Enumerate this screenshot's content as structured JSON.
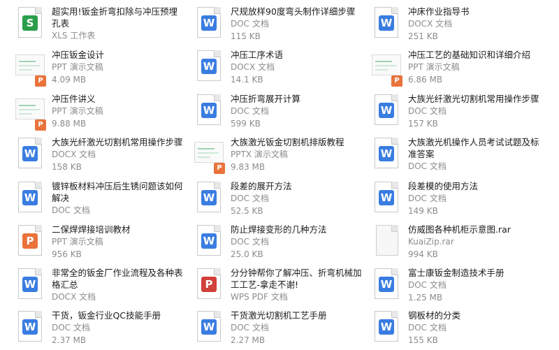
{
  "files": [
    {
      "name": "超实用!钣金折弯扣除与冲压预埋孔表",
      "type": "XLS 工作表",
      "size": "",
      "icon": "xls-icon"
    },
    {
      "name": "尺规放样90度弯头制作详细步骤",
      "type": "DOC 文档",
      "size": "115 KB",
      "icon": "doc-icon"
    },
    {
      "name": "冲床作业指导书",
      "type": "DOCX 文档",
      "size": "251 KB",
      "icon": "doc-icon"
    },
    {
      "name": "冲压钣金设计",
      "type": "PPT 演示文稿",
      "size": "4.09 MB",
      "icon": "ppt-thumbnail-icon"
    },
    {
      "name": "冲压工序术语",
      "type": "DOCX 文档",
      "size": "14.1 KB",
      "icon": "doc-icon"
    },
    {
      "name": "冲压工艺的基础知识和详细介绍",
      "type": "PPT 演示文稿",
      "size": "6.86 MB",
      "icon": "ppt-thumbnail-icon"
    },
    {
      "name": "冲压件讲义",
      "type": "PPT 演示文稿",
      "size": "9.88 MB",
      "icon": "ppt-thumbnail-icon"
    },
    {
      "name": "冲压折弯展开计算",
      "type": "DOC 文档",
      "size": "599 KB",
      "icon": "doc-icon"
    },
    {
      "name": "大族光纤激光切割机常用操作步骤",
      "type": "DOC 文档",
      "size": "157 KB",
      "icon": "doc-icon"
    },
    {
      "name": "大族光纤激光切割机常用操作步骤",
      "type": "DOCX 文档",
      "size": "158 KB",
      "icon": "doc-icon"
    },
    {
      "name": "大族激光钣金切割机排版教程",
      "type": "PPTX 演示文稿",
      "size": "9.83 MB",
      "icon": "ppt-thumbnail-icon"
    },
    {
      "name": "大族激光机操作人员考试试题及标准答案",
      "type": "DOC 文档",
      "size": "",
      "icon": "doc-icon"
    },
    {
      "name": "镀锌板材料冲压后生锈问题该如何解决",
      "type": "DOC 文档",
      "size": "",
      "icon": "doc-icon"
    },
    {
      "name": "段差的展开方法",
      "type": "DOC 文档",
      "size": "52.5 KB",
      "icon": "doc-icon"
    },
    {
      "name": "段差模的使用方法",
      "type": "DOC 文档",
      "size": "149 KB",
      "icon": "doc-icon"
    },
    {
      "name": "二保焊焊接培训教材",
      "type": "PPT 演示文稿",
      "size": "956 KB",
      "icon": "ppt-icon"
    },
    {
      "name": "防止焊接变形的几种方法",
      "type": "DOC 文档",
      "size": "25.0 KB",
      "icon": "doc-icon"
    },
    {
      "name": "仿威图各种机柜示意图.rar",
      "type": "KuaiZip.rar",
      "size": "994 KB",
      "icon": "archive-icon"
    },
    {
      "name": "非常全的钣金厂作业流程及各种表格汇总",
      "type": "DOCX 文档",
      "size": "",
      "icon": "doc-icon"
    },
    {
      "name": "分分钟帮你了解冲压、折弯机械加工工艺-拿走不谢!",
      "type": "WPS PDF 文档",
      "size": "",
      "icon": "pdf-icon"
    },
    {
      "name": "富士康钣金制造技术手册",
      "type": "DOC 文档",
      "size": "1.25 MB",
      "icon": "doc-icon"
    },
    {
      "name": "干货，钣金行业QC技能手册",
      "type": "DOC 文档",
      "size": "2.37 MB",
      "icon": "doc-icon"
    },
    {
      "name": "干货激光切割机工艺手册",
      "type": "DOC 文档",
      "size": "2.27 MB",
      "icon": "doc-icon"
    },
    {
      "name": "钢板材的分类",
      "type": "DOC 文档",
      "size": "155 KB",
      "icon": "doc-icon"
    }
  ]
}
